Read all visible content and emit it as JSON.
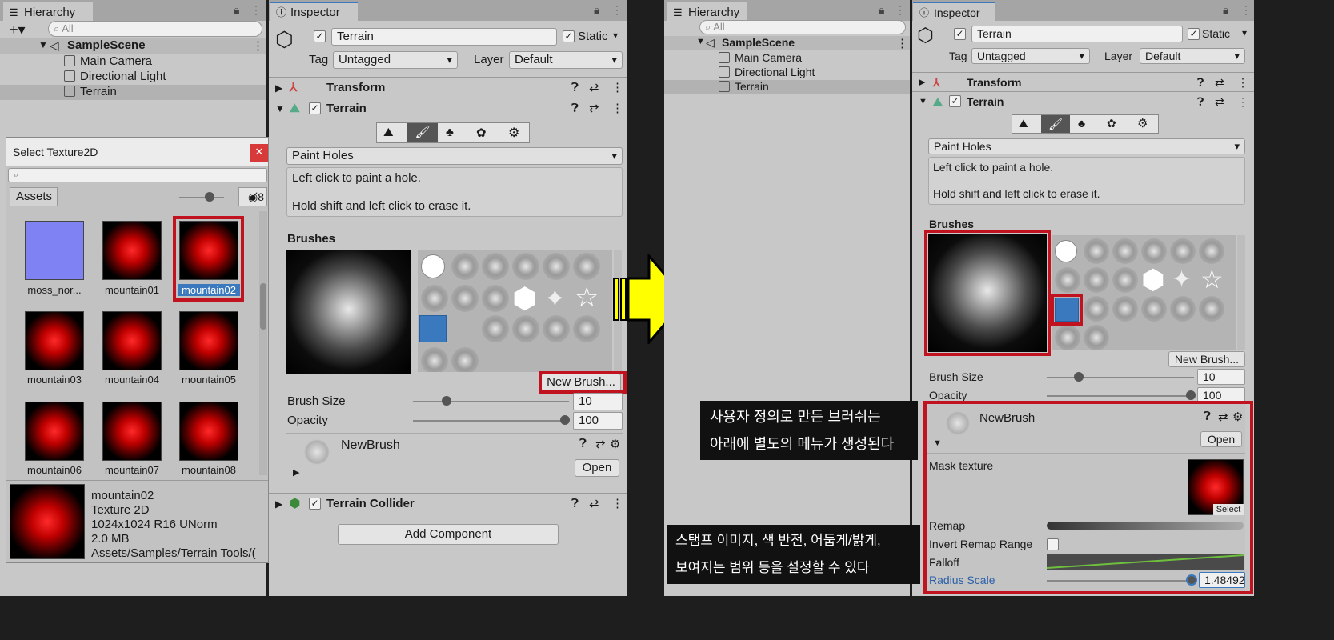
{
  "left": {
    "hierarchy": {
      "tab": "Hierarchy",
      "search_placeholder": "All",
      "scene": "SampleScene",
      "items": [
        "Main Camera",
        "Directional Light",
        "Terrain"
      ]
    },
    "inspector": {
      "tab": "Inspector",
      "object_name": "Terrain",
      "static_label": "Static",
      "tag_label": "Tag",
      "tag_value": "Untagged",
      "layer_label": "Layer",
      "layer_value": "Default",
      "transform": "Transform",
      "terrain": "Terrain",
      "tool_dropdown": "Paint Holes",
      "help1": "Left click to paint a hole.",
      "help2": "Hold shift and left click to erase it.",
      "brushes": "Brushes",
      "new_brush": "New Brush...",
      "brush_size_label": "Brush Size",
      "brush_size": "10",
      "opacity_label": "Opacity",
      "opacity": "100",
      "newbrush_name": "NewBrush",
      "open": "Open",
      "collider": "Terrain Collider",
      "add_component": "Add Component"
    },
    "picker": {
      "title": "Select Texture2D",
      "assets_tab": "Assets",
      "hidden_count": "8",
      "items": [
        "moss_nor...",
        "mountain01",
        "mountain02",
        "mountain03",
        "mountain04",
        "mountain05",
        "mountain06",
        "mountain07",
        "mountain08"
      ],
      "selected_name": "mountain02",
      "selected_type": "Texture 2D",
      "selected_format": "1024x1024  R16 UNorm",
      "selected_size": "2.0 MB",
      "selected_path": "Assets/Samples/Terrain Tools/("
    }
  },
  "right": {
    "hierarchy": {
      "tab": "Hierarchy",
      "search_placeholder": "All",
      "scene": "SampleScene",
      "items": [
        "Main Camera",
        "Directional Light",
        "Terrain"
      ]
    },
    "inspector": {
      "tab": "Inspector",
      "object_name": "Terrain",
      "static_label": "Static",
      "tag_label": "Tag",
      "tag_value": "Untagged",
      "layer_label": "Layer",
      "layer_value": "Default",
      "transform": "Transform",
      "terrain": "Terrain",
      "tool_dropdown": "Paint Holes",
      "help1": "Left click to paint a hole.",
      "help2": "Hold shift and left click to erase it.",
      "brushes": "Brushes",
      "new_brush": "New Brush...",
      "brush_size_label": "Brush Size",
      "brush_size": "10",
      "opacity_label": "Opacity",
      "opacity": "100",
      "newbrush_name": "NewBrush",
      "open": "Open",
      "mask_texture": "Mask texture",
      "select": "Select",
      "remap": "Remap",
      "invert_remap": "Invert Remap Range",
      "falloff": "Falloff",
      "radius_scale": "Radius Scale",
      "radius_value": "1.48492"
    }
  },
  "captions": {
    "c1_line1": "사용자 정의로 만든 브러쉬는",
    "c1_line2": "아래에 별도의 메뉴가 생성된다",
    "c2_line1": "스탬프 이미지, 색 반전, 어둡게/밝게,",
    "c2_line2": "보여지는 범위 등을 설정할 수 있다"
  },
  "colors": {
    "highlight_red": "#c1121f",
    "selection_blue": "#3a79bd",
    "arrow_yellow": "#ffff00"
  }
}
